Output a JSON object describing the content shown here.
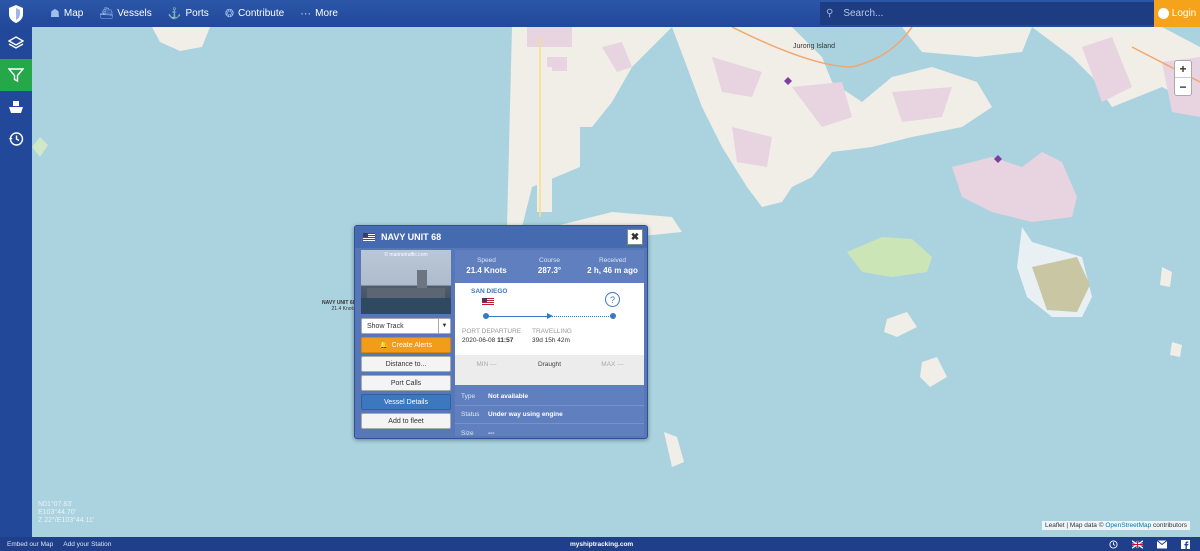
{
  "nav": {
    "items": [
      {
        "label": "Map",
        "icon": "map-icon"
      },
      {
        "label": "Vessels",
        "icon": "ship-icon"
      },
      {
        "label": "Ports",
        "icon": "anchor-icon"
      },
      {
        "label": "Contribute",
        "icon": "contribute-icon"
      },
      {
        "label": "More",
        "icon": "more-icon"
      }
    ],
    "search_placeholder": "Search...",
    "login_label": "Login"
  },
  "sidebar": {
    "items": [
      {
        "name": "layers",
        "icon": "layers-icon"
      },
      {
        "name": "filter",
        "icon": "filter-icon",
        "active": true
      },
      {
        "name": "ship",
        "icon": "ship-icon"
      },
      {
        "name": "history",
        "icon": "history-icon"
      }
    ]
  },
  "map": {
    "place_label": "Jurong Island",
    "zoom_in": "+",
    "zoom_out": "−",
    "coords": [
      "N01°07.83'",
      "E103°44.70'",
      "Z 22°/E103°44.11'"
    ],
    "attribution_prefix": "Leaflet | Map data © ",
    "attribution_link": "OpenStreetMap",
    "attribution_suffix": " contributors",
    "ship_label_name": "NAVY UNIT 68",
    "ship_label_speed": "21.4 Knots"
  },
  "popup": {
    "title": "NAVY UNIT 68",
    "photo_caption": "© marinetraffic.com",
    "buttons": {
      "show_track": "Show Track",
      "create_alerts": "Create Alerts",
      "distance_to": "Distance to...",
      "port_calls": "Port Calls",
      "vessel_details": "Vessel Details",
      "add_to_fleet": "Add to fleet"
    },
    "stats": {
      "speed_label": "Speed",
      "speed_value": "21.4 Knots",
      "course_label": "Course",
      "course_value": "287.3°",
      "received_label": "Received",
      "received_value": "2 h, 46 m ago"
    },
    "route": {
      "departure_port": "SAN DIEGO",
      "departure_label": "PORT DEPARTURE",
      "departure_date": "2020-06-08",
      "departure_time": "11:57",
      "travelling_label": "TRAVELLING",
      "travelling_value": "39d 15h 42m"
    },
    "draught": {
      "min": "MIN ---",
      "label": "Draught",
      "max": "MAX ---"
    },
    "info": [
      {
        "key": "Type",
        "value": "Not available"
      },
      {
        "key": "Status",
        "value": "Under way using engine"
      },
      {
        "key": "Size",
        "value": "---"
      }
    ]
  },
  "footer": {
    "embed": "Embed our Map",
    "add_station": "Add your Station",
    "site": "myshiptracking.com"
  }
}
